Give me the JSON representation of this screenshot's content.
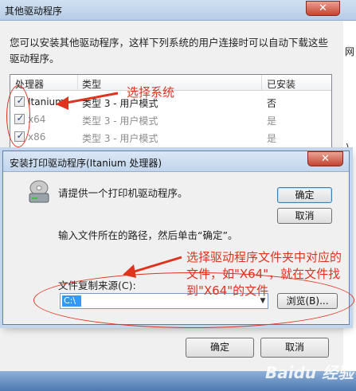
{
  "outer_dialog": {
    "title": "其他驱动程序",
    "close_glyph": "✕",
    "description": "您可以安装其他驱动程序，这样下列系统的用户连接时可以自动下载这些驱动程序。",
    "table": {
      "headers": [
        "处理器",
        "类型",
        "已安装"
      ],
      "rows": [
        {
          "processor": "Itanium",
          "type": "类型 3 - 用户模式",
          "installed": "否",
          "checked": true
        },
        {
          "processor": "x64",
          "type": "类型 3 - 用户模式",
          "installed": "是",
          "checked": true
        },
        {
          "processor": "x86",
          "type": "类型 3 - 用户模式",
          "installed": "是",
          "checked": true
        }
      ]
    },
    "ok_label": "确定",
    "cancel_label": "取消"
  },
  "inner_dialog": {
    "title": "安装打印驱动程序(Itanium 处理器)",
    "close_glyph": "✕",
    "prompt": "请提供一个打印机驱动程序。",
    "instruction": "输入文件所在的路径，然后单击“确定”。",
    "ok_label": "确定",
    "cancel_label": "取消",
    "source_label": "文件复制来源(C):",
    "source_value": "C:\\",
    "browse_label": "浏览(B)..."
  },
  "annotations": {
    "select_system": "选择系统",
    "select_folder": [
      "选择驱动程序文件夹中对应的",
      "文件，如\"X64\"，就在文件找",
      "到\"X64\"的文件"
    ]
  },
  "background": {
    "right_glyphs": [
      "网",
      "\\",
      "F"
    ],
    "watermark": "Baidu 经验"
  },
  "colors": {
    "annotation_red": "#e0321f",
    "checkmark": "#2b4a86",
    "selection": "#3399ff"
  }
}
